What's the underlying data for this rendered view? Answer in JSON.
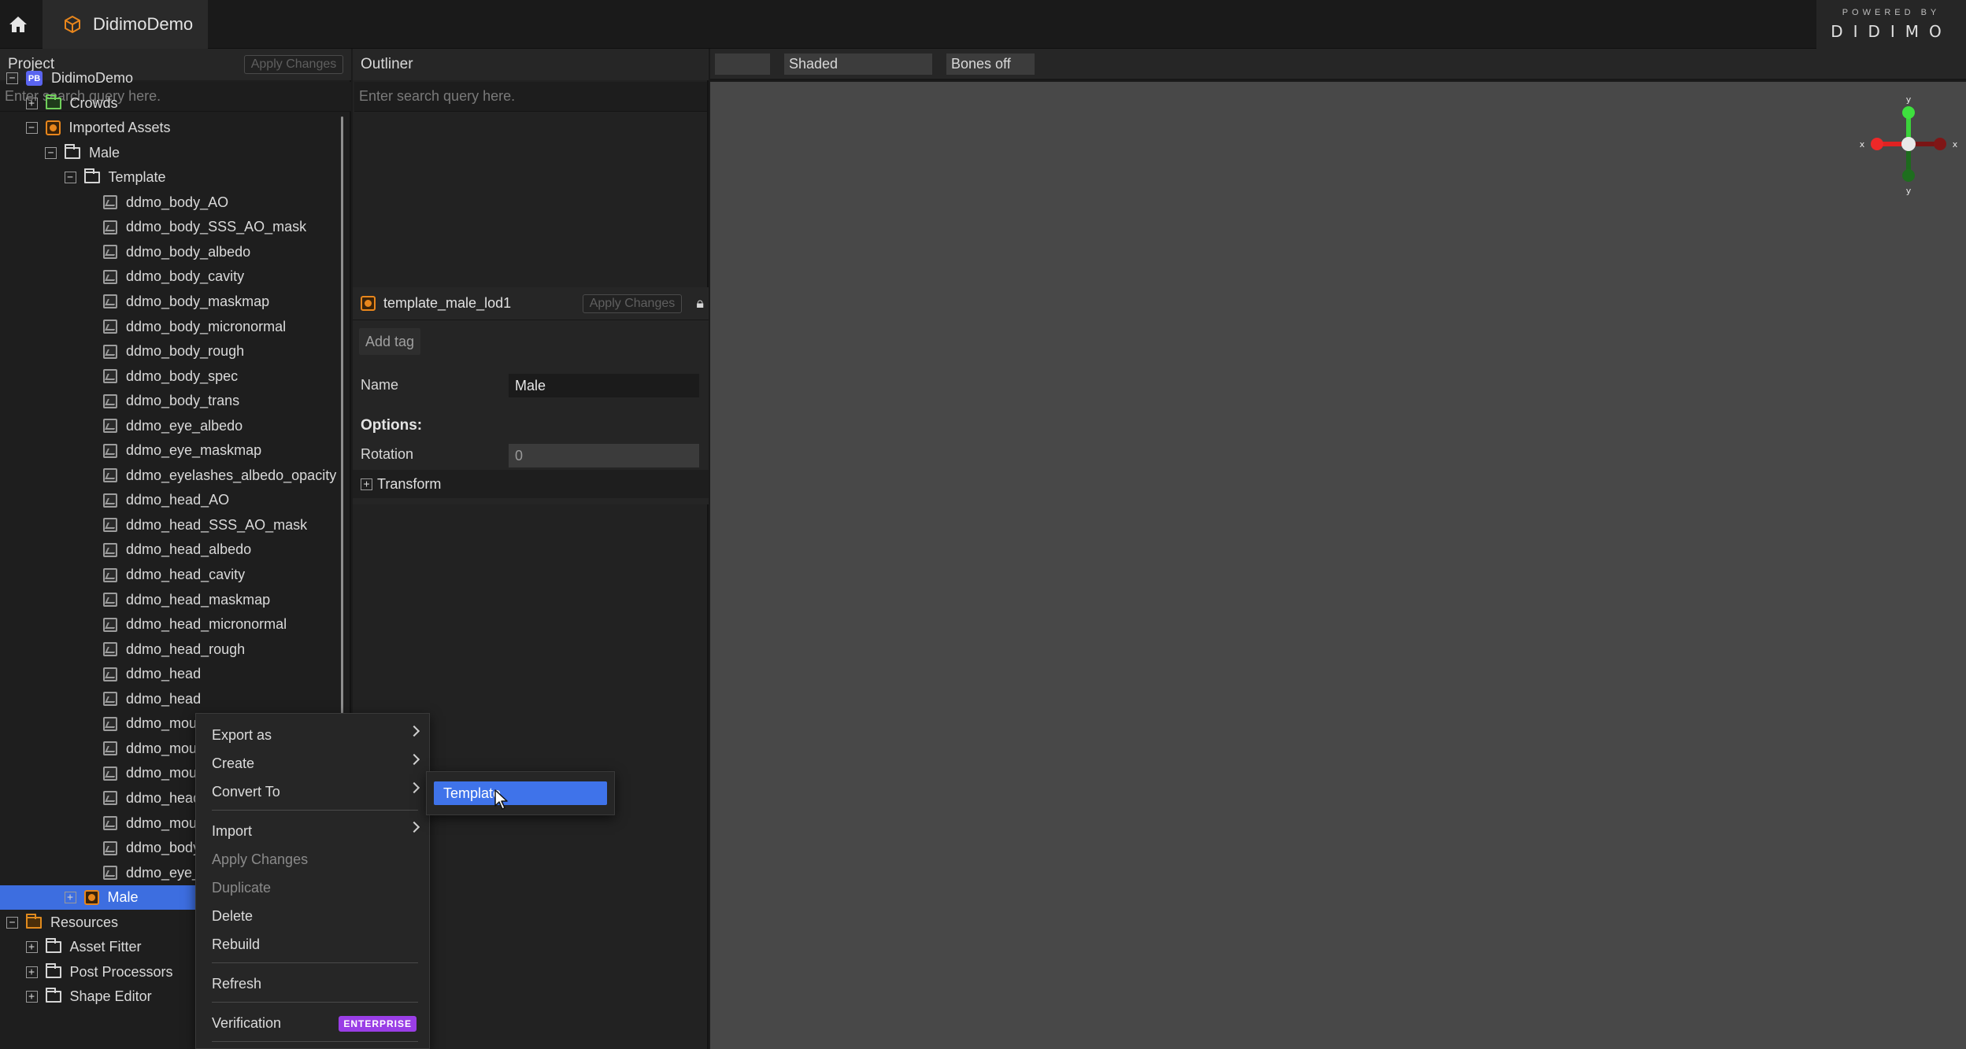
{
  "topbar": {
    "tab_title": "DidimoDemo",
    "brand_top": "POWERED BY",
    "brand_bottom": "DIDIMO"
  },
  "project": {
    "title": "Project",
    "apply_label": "Apply Changes",
    "search_placeholder": "Enter search query here.",
    "tree": [
      {
        "label": "DidimoDemo",
        "icon": "pb-icon",
        "depth": 0,
        "expander": "−"
      },
      {
        "label": "Crowds",
        "icon": "folder-green-icon",
        "depth": 1,
        "expander": "+"
      },
      {
        "label": "Imported Assets",
        "icon": "asset-icon",
        "depth": 1,
        "expander": "−"
      },
      {
        "label": "Male",
        "icon": "folder-icon",
        "depth": 2,
        "expander": "−"
      },
      {
        "label": "Template",
        "icon": "folder-icon",
        "depth": 3,
        "expander": "−"
      },
      {
        "label": "ddmo_body_AO",
        "icon": "texture-icon",
        "depth": 4
      },
      {
        "label": "ddmo_body_SSS_AO_mask",
        "icon": "texture-icon",
        "depth": 4
      },
      {
        "label": "ddmo_body_albedo",
        "icon": "texture-icon",
        "depth": 4
      },
      {
        "label": "ddmo_body_cavity",
        "icon": "texture-icon",
        "depth": 4
      },
      {
        "label": "ddmo_body_maskmap",
        "icon": "texture-icon",
        "depth": 4
      },
      {
        "label": "ddmo_body_micronormal",
        "icon": "texture-icon",
        "depth": 4
      },
      {
        "label": "ddmo_body_rough",
        "icon": "texture-icon",
        "depth": 4
      },
      {
        "label": "ddmo_body_spec",
        "icon": "texture-icon",
        "depth": 4
      },
      {
        "label": "ddmo_body_trans",
        "icon": "texture-icon",
        "depth": 4
      },
      {
        "label": "ddmo_eye_albedo",
        "icon": "texture-icon",
        "depth": 4
      },
      {
        "label": "ddmo_eye_maskmap",
        "icon": "texture-icon",
        "depth": 4
      },
      {
        "label": "ddmo_eyelashes_albedo_opacity",
        "icon": "texture-icon",
        "depth": 4
      },
      {
        "label": "ddmo_head_AO",
        "icon": "texture-icon",
        "depth": 4
      },
      {
        "label": "ddmo_head_SSS_AO_mask",
        "icon": "texture-icon",
        "depth": 4
      },
      {
        "label": "ddmo_head_albedo",
        "icon": "texture-icon",
        "depth": 4
      },
      {
        "label": "ddmo_head_cavity",
        "icon": "texture-icon",
        "depth": 4
      },
      {
        "label": "ddmo_head_maskmap",
        "icon": "texture-icon",
        "depth": 4
      },
      {
        "label": "ddmo_head_micronormal",
        "icon": "texture-icon",
        "depth": 4
      },
      {
        "label": "ddmo_head_rough",
        "icon": "texture-icon",
        "depth": 4
      },
      {
        "label": "ddmo_head",
        "icon": "texture-icon",
        "depth": 4
      },
      {
        "label": "ddmo_head",
        "icon": "texture-icon",
        "depth": 4
      },
      {
        "label": "ddmo_mout",
        "icon": "texture-icon",
        "depth": 4
      },
      {
        "label": "ddmo_mout",
        "icon": "texture-icon",
        "depth": 4
      },
      {
        "label": "ddmo_mout",
        "icon": "texture-icon",
        "depth": 4
      },
      {
        "label": "ddmo_head",
        "icon": "texture-icon",
        "depth": 4
      },
      {
        "label": "ddmo_mout",
        "icon": "texture-icon",
        "depth": 4
      },
      {
        "label": "ddmo_body",
        "icon": "texture-icon",
        "depth": 4
      },
      {
        "label": "ddmo_eye_",
        "icon": "texture-icon",
        "depth": 4
      },
      {
        "label": "Male",
        "icon": "asset-icon",
        "depth": 3,
        "expander": "+",
        "selected": true
      },
      {
        "label": "Resources",
        "icon": "folder-orange-icon",
        "depth": 0,
        "expander": "−"
      },
      {
        "label": "Asset Fitter",
        "icon": "folder-icon",
        "depth": 1,
        "expander": "+"
      },
      {
        "label": "Post Processors",
        "icon": "folder-icon",
        "depth": 1,
        "expander": "+"
      },
      {
        "label": "Shape Editor",
        "icon": "folder-icon",
        "depth": 1,
        "expander": "+"
      }
    ]
  },
  "outliner": {
    "title": "Outliner",
    "search_placeholder": "Enter search query here."
  },
  "inspector": {
    "title": "template_male_lod1",
    "apply_label": "Apply Changes",
    "add_tag": "Add tag",
    "name_label": "Name",
    "name_value": "Male",
    "options_label": "Options:",
    "rotation_label": "Rotation",
    "rotation_value": "0",
    "transform_label": "Transform"
  },
  "viewport": {
    "mode_blank": "",
    "shading": "Shaded",
    "bones": "Bones off",
    "gizmo_axis_y": "y",
    "gizmo_axis_x": "x"
  },
  "context_menu": {
    "items": [
      {
        "label": "Export as",
        "submenu": true
      },
      {
        "label": "Create",
        "submenu": true
      },
      {
        "label": "Convert To",
        "submenu": true
      },
      {
        "label": "Import",
        "submenu": true
      },
      {
        "label": "Apply Changes",
        "disabled": true
      },
      {
        "label": "Duplicate",
        "disabled": true
      },
      {
        "label": "Delete"
      },
      {
        "label": "Rebuild"
      },
      {
        "label": "Refresh"
      },
      {
        "label": "Verification",
        "badge": "ENTERPRISE"
      }
    ],
    "submenu_item": "Template"
  },
  "colors": {
    "accent": "#3d6ee0",
    "asset_orange": "#e8861c",
    "enterprise_badge": "#9a3ee6",
    "viewport_bg": "#484848"
  }
}
